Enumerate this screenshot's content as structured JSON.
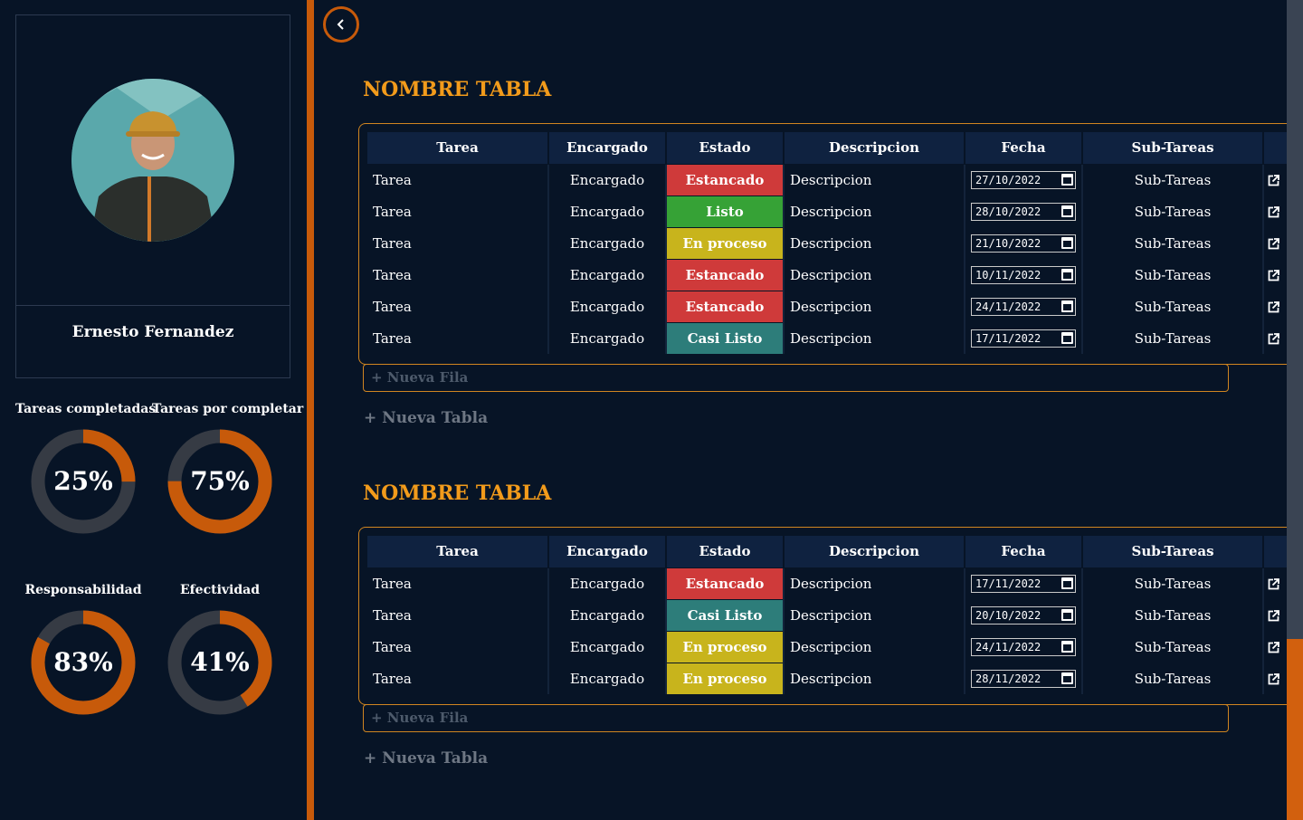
{
  "profile": {
    "name": "Ernesto Fernandez"
  },
  "stats": [
    {
      "label": "Tareas completadas",
      "value_text": "25%",
      "value": 0.25
    },
    {
      "label": "Tareas por completar",
      "value_text": "75%",
      "value": 0.75
    },
    {
      "label": "Responsabilidad",
      "value_text": "83%",
      "value": 0.83
    },
    {
      "label": "Efectividad",
      "value_text": "41%",
      "value": 0.41
    }
  ],
  "colors": {
    "accent": "#c75a0a",
    "title": "#f29b1b",
    "bg": "#071426",
    "estancado": "#cf3a3a",
    "listo": "#36a236",
    "en_proceso": "#c8b41c",
    "casi_listo": "#2d7d7a"
  },
  "columns": [
    "Tarea",
    "Encargado",
    "Estado",
    "Descripcion",
    "Fecha",
    "Sub-Tareas"
  ],
  "tables": [
    {
      "title": "NOMBRE TABLA",
      "new_row_placeholder": "+ Nueva Fila",
      "new_table_label": "+ Nueva Tabla",
      "rows": [
        {
          "tarea": "Tarea",
          "encargado": "Encargado",
          "estado": "Estancado",
          "descripcion": "Descripcion",
          "fecha": "27/10/2022",
          "subtareas": "Sub-Tareas"
        },
        {
          "tarea": "Tarea",
          "encargado": "Encargado",
          "estado": "Listo",
          "descripcion": "Descripcion",
          "fecha": "28/10/2022",
          "subtareas": "Sub-Tareas"
        },
        {
          "tarea": "Tarea",
          "encargado": "Encargado",
          "estado": "En proceso",
          "descripcion": "Descripcion",
          "fecha": "21/10/2022",
          "subtareas": "Sub-Tareas"
        },
        {
          "tarea": "Tarea",
          "encargado": "Encargado",
          "estado": "Estancado",
          "descripcion": "Descripcion",
          "fecha": "10/11/2022",
          "subtareas": "Sub-Tareas"
        },
        {
          "tarea": "Tarea",
          "encargado": "Encargado",
          "estado": "Estancado",
          "descripcion": "Descripcion",
          "fecha": "24/11/2022",
          "subtareas": "Sub-Tareas"
        },
        {
          "tarea": "Tarea",
          "encargado": "Encargado",
          "estado": "Casi Listo",
          "descripcion": "Descripcion",
          "fecha": "17/11/2022",
          "subtareas": "Sub-Tareas"
        }
      ]
    },
    {
      "title": "NOMBRE TABLA",
      "new_row_placeholder": "+ Nueva Fila",
      "new_table_label": "+ Nueva Tabla",
      "rows": [
        {
          "tarea": "Tarea",
          "encargado": "Encargado",
          "estado": "Estancado",
          "descripcion": "Descripcion",
          "fecha": "17/11/2022",
          "subtareas": "Sub-Tareas"
        },
        {
          "tarea": "Tarea",
          "encargado": "Encargado",
          "estado": "Casi Listo",
          "descripcion": "Descripcion",
          "fecha": "20/10/2022",
          "subtareas": "Sub-Tareas"
        },
        {
          "tarea": "Tarea",
          "encargado": "Encargado",
          "estado": "En proceso",
          "descripcion": "Descripcion",
          "fecha": "24/11/2022",
          "subtareas": "Sub-Tareas"
        },
        {
          "tarea": "Tarea",
          "encargado": "Encargado",
          "estado": "En proceso",
          "descripcion": "Descripcion",
          "fecha": "28/11/2022",
          "subtareas": "Sub-Tareas"
        }
      ]
    }
  ],
  "icons": {
    "back": "chevron-left-icon",
    "date": "calendar-icon",
    "open": "external-link-icon"
  }
}
